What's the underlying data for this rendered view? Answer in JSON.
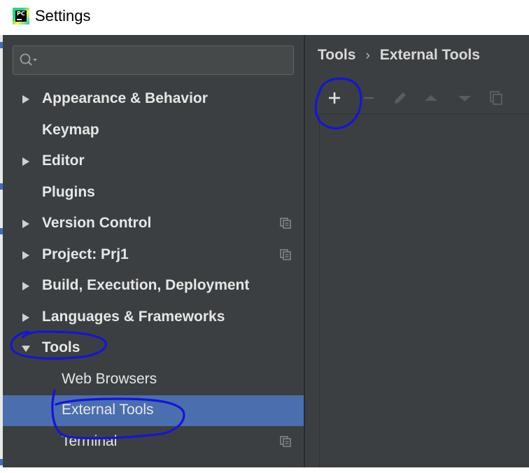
{
  "window": {
    "title": "Settings"
  },
  "search": {
    "placeholder": ""
  },
  "tree": [
    {
      "label": "Appearance & Behavior",
      "expanded": false,
      "has_arrow": true,
      "level": 0,
      "bold": true,
      "project_icon": false
    },
    {
      "label": "Keymap",
      "has_arrow": false,
      "level": 0,
      "bold": true,
      "project_icon": false
    },
    {
      "label": "Editor",
      "expanded": false,
      "has_arrow": true,
      "level": 0,
      "bold": true,
      "project_icon": false
    },
    {
      "label": "Plugins",
      "has_arrow": false,
      "level": 0,
      "bold": true,
      "project_icon": false
    },
    {
      "label": "Version Control",
      "expanded": false,
      "has_arrow": true,
      "level": 0,
      "bold": true,
      "project_icon": true
    },
    {
      "label": "Project: Prj1",
      "expanded": false,
      "has_arrow": true,
      "level": 0,
      "bold": true,
      "project_icon": true
    },
    {
      "label": "Build, Execution, Deployment",
      "expanded": false,
      "has_arrow": true,
      "level": 0,
      "bold": true,
      "project_icon": false
    },
    {
      "label": "Languages & Frameworks",
      "expanded": false,
      "has_arrow": true,
      "level": 0,
      "bold": true,
      "project_icon": false
    },
    {
      "label": "Tools",
      "expanded": true,
      "has_arrow": true,
      "level": 0,
      "bold": true,
      "project_icon": false
    },
    {
      "label": "Web Browsers",
      "has_arrow": false,
      "level": 1,
      "bold": false,
      "project_icon": false
    },
    {
      "label": "External Tools",
      "has_arrow": false,
      "level": 1,
      "bold": false,
      "selected": true,
      "project_icon": false
    },
    {
      "label": "Terminal",
      "has_arrow": false,
      "level": 1,
      "bold": false,
      "project_icon": true
    }
  ],
  "breadcrumb": {
    "parent": "Tools",
    "separator": "›",
    "current": "External Tools"
  },
  "toolbar": {
    "buttons": [
      {
        "icon": "add-icon",
        "enabled": true
      },
      {
        "icon": "remove-icon",
        "enabled": false
      },
      {
        "icon": "edit-icon",
        "enabled": false
      },
      {
        "icon": "move-up-icon",
        "enabled": false
      },
      {
        "icon": "move-down-icon",
        "enabled": false
      },
      {
        "icon": "copy-icon",
        "enabled": false
      }
    ]
  },
  "colors": {
    "background": "#3c3f41",
    "selection": "#4b6eaf",
    "text": "#e6e6e6",
    "annotation": "#1515d6"
  }
}
